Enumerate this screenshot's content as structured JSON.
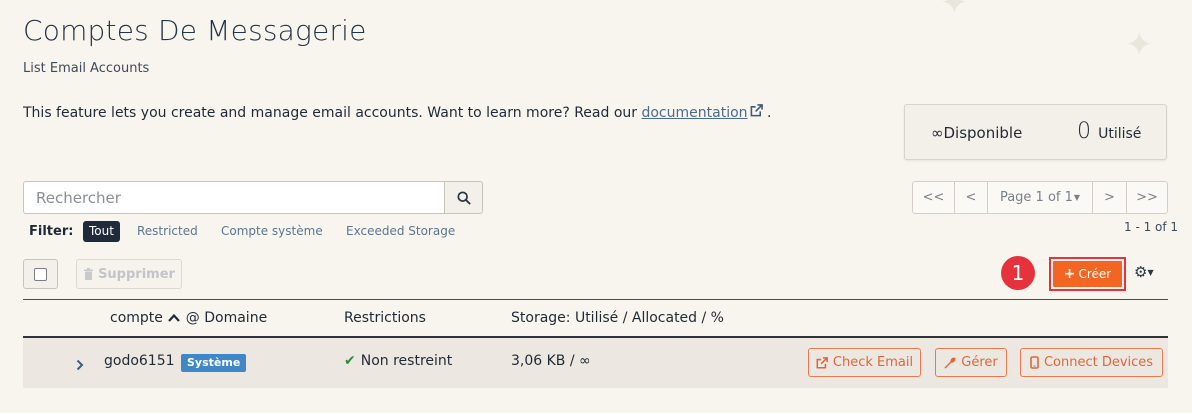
{
  "header": {
    "title": "Comptes De Messagerie",
    "subtitle": "List Email Accounts"
  },
  "intro": {
    "text": "This feature lets you create and manage email accounts. Want to learn more? Read our",
    "link": "documentation",
    "period": "."
  },
  "stats": {
    "available_symbol": "∞",
    "available_label": "Disponible",
    "used_value": "0",
    "used_label": "Utilisé"
  },
  "search": {
    "placeholder": "Rechercher",
    "icon": "search-icon"
  },
  "filter": {
    "label": "Filter:",
    "options": [
      "Tout",
      "Restricted",
      "Compte système",
      "Exceeded Storage"
    ],
    "selected": "Tout"
  },
  "pagination": {
    "first": "<<",
    "prev": "<",
    "page_label": "Page 1 of 1",
    "next": ">",
    "last": ">>",
    "range": "1 - 1 of 1"
  },
  "toolbar": {
    "delete_label": "Supprimer",
    "create_label": "Créer",
    "step_number": "1",
    "settings_icon": "gear-icon"
  },
  "table": {
    "columns": {
      "account": "compte",
      "domain": "@ Domaine",
      "restrictions": "Restrictions",
      "storage": "Storage: Utilisé / Allocated / %"
    },
    "rows": [
      {
        "account": "godo6151",
        "badge": "Système",
        "restriction": "Non restreint",
        "storage": "3,06 KB / ∞",
        "actions": [
          "Check Email",
          "Gérer",
          "Connect Devices"
        ]
      }
    ]
  },
  "colors": {
    "background": "#f8f5ef",
    "accent_orange": "#f26522",
    "highlight_red": "#e5323c",
    "badge_blue": "#3f87c6",
    "active_chip": "#1f2a3a"
  }
}
